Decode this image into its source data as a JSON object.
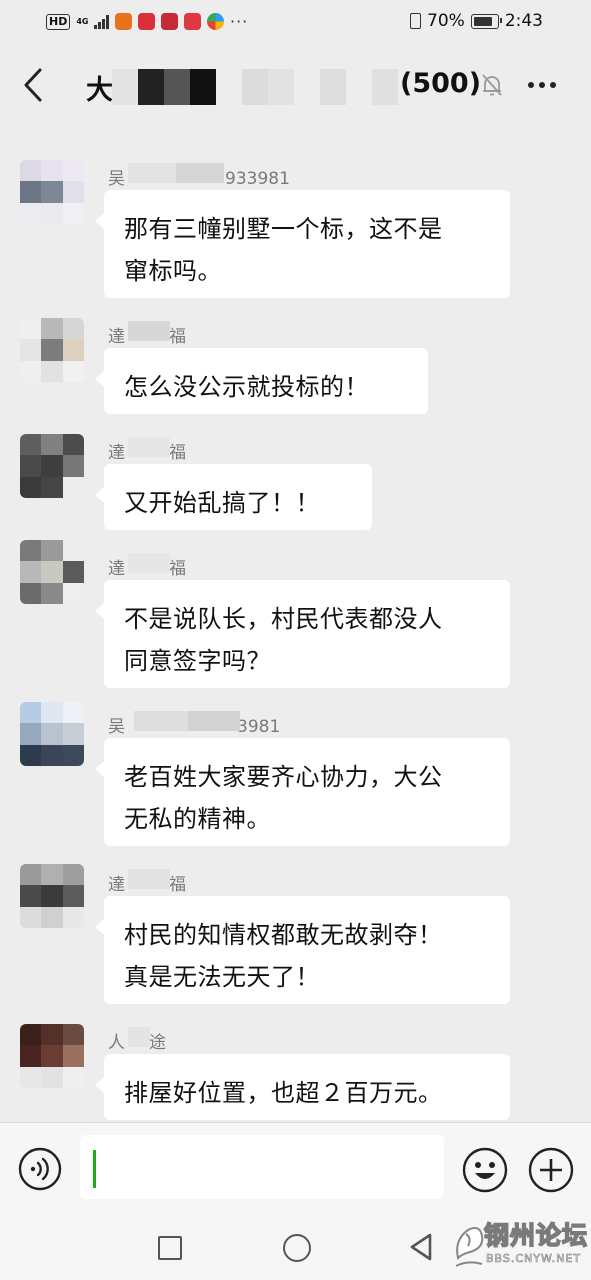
{
  "status_bar": {
    "hd": "HD",
    "network": "4G",
    "more": "···",
    "battery": "70%",
    "time": "2:43"
  },
  "header": {
    "title_prefix": "大",
    "title_suffix": "(500)",
    "icons": {
      "back": "back-arrow-icon",
      "mute": "bell-muted-icon",
      "more": "more-icon"
    }
  },
  "messages": [
    {
      "sender_pre": "吴",
      "sender_post": "933981",
      "lines": [
        "那有三幢别墅一个标，这不是",
        "窜标吗。"
      ]
    },
    {
      "sender_pre": "達",
      "sender_post": "福",
      "lines": [
        "怎么没公示就投标的！"
      ]
    },
    {
      "sender_pre": "達",
      "sender_post": "福",
      "lines": [
        "又开始乱搞了！！"
      ]
    },
    {
      "sender_pre": "達",
      "sender_post": "福",
      "lines": [
        "不是说队长，村民代表都没人",
        "同意签字吗？"
      ]
    },
    {
      "sender_pre": "吴",
      "sender_post": "3981",
      "lines": [
        "老百姓大家要齐心协力，大公",
        "无私的精神。"
      ]
    },
    {
      "sender_pre": "達",
      "sender_post": "福",
      "lines": [
        "村民的知情权都敢无故剥夺！",
        "真是无法无天了！"
      ]
    },
    {
      "sender_pre": "人",
      "sender_post": "途",
      "lines": [
        "排屋好位置，也超２百万元。"
      ]
    }
  ],
  "input_bar": {
    "value": "",
    "placeholder": ""
  },
  "watermark": {
    "name": "钢州论坛",
    "url": "BBS.CNYW.NET"
  },
  "colors": {
    "background": "#ededed",
    "bubble": "#ffffff",
    "cursor": "#1aad19",
    "sender": "#7a7a7a"
  }
}
